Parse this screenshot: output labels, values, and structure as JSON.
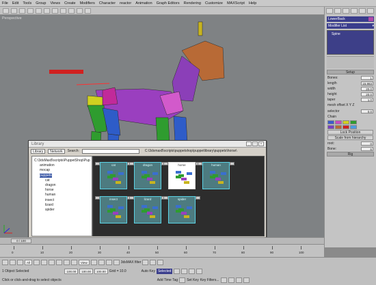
{
  "menu": [
    "File",
    "Edit",
    "Tools",
    "Group",
    "Views",
    "Create",
    "Modifiers",
    "Character",
    "reactor",
    "Animation",
    "Graph Editors",
    "Rendering",
    "Customize",
    "MAXScript",
    "Help"
  ],
  "viewport": {
    "label": "Perspective"
  },
  "command_panel": {
    "object_name": "LowerBack",
    "modifier_list": "Modifier List",
    "stack_item": "Spine",
    "rollout_setup": "Setup",
    "bones_label": "Bones:",
    "bones_value": "1",
    "length_label": "length",
    "length_value": "15.983",
    "width_label": "width",
    "width_value": "20.0",
    "height_label": "height",
    "height_value": "20.0",
    "taper_label": "taper",
    "taper_value": "1.0",
    "mesh_offset": "mesh offset X Y Z",
    "selector_label": "selector",
    "selector_value": "0.0",
    "chain_label": "Chain",
    "lock_position": "Lock Position",
    "scale_from_hierarchy": "Scale from hierarchy",
    "root_label": "root:",
    "root_value": "0",
    "bone_label": "Bone:",
    "bone_value": "6",
    "rig_label": "Rig"
  },
  "library": {
    "title": "Library",
    "library_dropdown": "Library",
    "network_dropdown": "Network",
    "search_label": "Search:",
    "path": "C:\\3dsmax8\\scripts\\puppetshop\\puppetlibrary\\puppets\\horse\\",
    "tree": [
      {
        "label": "C:\\3dsMax8\\scripts\\PuppetShop\\Pup",
        "level": 0,
        "selected": false
      },
      {
        "label": "animation",
        "level": 1,
        "selected": false
      },
      {
        "label": "mocap",
        "level": 1,
        "selected": false
      },
      {
        "label": "puppets",
        "level": 1,
        "selected": true
      },
      {
        "label": "cat",
        "level": 2,
        "selected": false
      },
      {
        "label": "dragon",
        "level": 2,
        "selected": false
      },
      {
        "label": "horse",
        "level": 2,
        "selected": false
      },
      {
        "label": "human",
        "level": 2,
        "selected": false
      },
      {
        "label": "insect",
        "level": 2,
        "selected": false
      },
      {
        "label": "lizard",
        "level": 2,
        "selected": false
      },
      {
        "label": "spider",
        "level": 2,
        "selected": false
      }
    ],
    "thumbnails": [
      {
        "name": "cat",
        "selected": false
      },
      {
        "name": "dragon",
        "selected": false
      },
      {
        "name": "horse",
        "selected": true
      },
      {
        "name": "human",
        "selected": false
      },
      {
        "name": "insect",
        "selected": false
      },
      {
        "name": "lizard",
        "selected": false
      },
      {
        "name": "spider",
        "selected": false
      }
    ]
  },
  "timeline": {
    "frame": "0 / 100",
    "ticks": [
      "0",
      "10",
      "20",
      "30",
      "40",
      "50",
      "60",
      "70",
      "80",
      "90",
      "100"
    ]
  },
  "status": {
    "selection": "1 Object Selected",
    "hint": "Click or click-and-drag to select objects",
    "x_value": "100.00",
    "y_value": "100.00",
    "z_value": "100.00",
    "grid": "Grid = 10.0",
    "add_time_tag": "Add Time Tag",
    "auto_key": "Auto Key",
    "set_key": "Set Key",
    "selected": "Selected",
    "key_filters": "Key Filters...",
    "view_dropdown": "View",
    "all_dropdown": "All",
    "radiofilter": "3dsMAX filter"
  }
}
